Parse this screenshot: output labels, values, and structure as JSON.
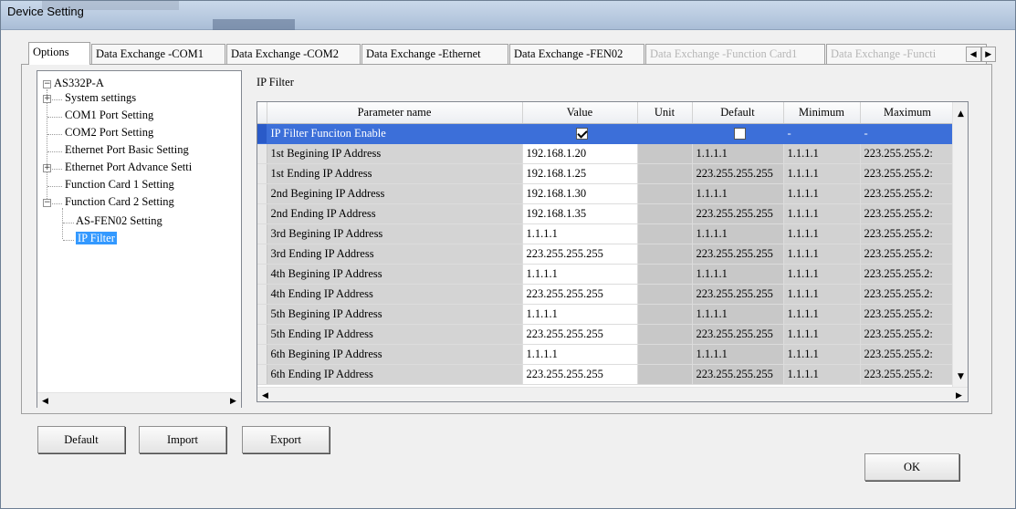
{
  "window": {
    "title": "Device Setting"
  },
  "tabs": [
    {
      "label": "Options",
      "state": "active"
    },
    {
      "label": "Data Exchange -COM1",
      "state": "normal"
    },
    {
      "label": "Data Exchange -COM2",
      "state": "normal"
    },
    {
      "label": "Data Exchange -Ethernet",
      "state": "normal"
    },
    {
      "label": "Data Exchange -FEN02",
      "state": "normal"
    },
    {
      "label": "Data Exchange -Function Card1",
      "state": "disabled"
    },
    {
      "label": "Data Exchange -Functi",
      "state": "disabled"
    }
  ],
  "tab_scroll": {
    "left_icon": "triangle-left-icon",
    "right_icon": "triangle-right-icon"
  },
  "tree": {
    "root": "AS332P-A",
    "items": [
      {
        "label": "System settings",
        "expander": "+"
      },
      {
        "label": "COM1 Port Setting",
        "expander": ""
      },
      {
        "label": "COM2 Port Setting",
        "expander": ""
      },
      {
        "label": "Ethernet Port Basic Setting",
        "expander": ""
      },
      {
        "label": "Ethernet Port Advance Setti",
        "expander": "+"
      },
      {
        "label": "Function Card 1 Setting",
        "expander": ""
      },
      {
        "label": "Function Card 2 Setting",
        "expander": "-"
      }
    ],
    "children": [
      {
        "label": "AS-FEN02 Setting"
      },
      {
        "label": "IP Filter",
        "selected": true
      }
    ]
  },
  "section_label": "IP Filter",
  "grid": {
    "columns": [
      "Parameter name",
      "Value",
      "Unit",
      "Default",
      "Minimum",
      "Maximum"
    ],
    "rows": [
      {
        "name": "IP Filter Funciton Enable",
        "value": "",
        "value_checkbox": true,
        "value_checked": true,
        "unit": "",
        "default": "",
        "default_checkbox": true,
        "default_checked": false,
        "min": "-",
        "max": "-",
        "selected": true
      },
      {
        "name": "1st Begining IP Address",
        "value": "192.168.1.20",
        "unit": "",
        "default": "1.1.1.1",
        "min": "1.1.1.1",
        "max": "223.255.255.2:"
      },
      {
        "name": "1st Ending IP Address",
        "value": "192.168.1.25",
        "unit": "",
        "default": "223.255.255.255",
        "min": "1.1.1.1",
        "max": "223.255.255.2:"
      },
      {
        "name": "2nd Begining IP Address",
        "value": "192.168.1.30",
        "unit": "",
        "default": "1.1.1.1",
        "min": "1.1.1.1",
        "max": "223.255.255.2:"
      },
      {
        "name": "2nd Ending IP Address",
        "value": "192.168.1.35",
        "unit": "",
        "default": "223.255.255.255",
        "min": "1.1.1.1",
        "max": "223.255.255.2:"
      },
      {
        "name": "3rd Begining IP Address",
        "value": "1.1.1.1",
        "unit": "",
        "default": "1.1.1.1",
        "min": "1.1.1.1",
        "max": "223.255.255.2:"
      },
      {
        "name": "3rd Ending IP Address",
        "value": "223.255.255.255",
        "unit": "",
        "default": "223.255.255.255",
        "min": "1.1.1.1",
        "max": "223.255.255.2:"
      },
      {
        "name": "4th Begining IP Address",
        "value": "1.1.1.1",
        "unit": "",
        "default": "1.1.1.1",
        "min": "1.1.1.1",
        "max": "223.255.255.2:"
      },
      {
        "name": "4th Ending IP Address",
        "value": "223.255.255.255",
        "unit": "",
        "default": "223.255.255.255",
        "min": "1.1.1.1",
        "max": "223.255.255.2:"
      },
      {
        "name": "5th Begining IP Address",
        "value": "1.1.1.1",
        "unit": "",
        "default": "1.1.1.1",
        "min": "1.1.1.1",
        "max": "223.255.255.2:"
      },
      {
        "name": "5th Ending IP Address",
        "value": "223.255.255.255",
        "unit": "",
        "default": "223.255.255.255",
        "min": "1.1.1.1",
        "max": "223.255.255.2:"
      },
      {
        "name": "6th Begining IP Address",
        "value": "1.1.1.1",
        "unit": "",
        "default": "1.1.1.1",
        "min": "1.1.1.1",
        "max": "223.255.255.2:"
      },
      {
        "name": "6th Ending IP Address",
        "value": "223.255.255.255",
        "unit": "",
        "default": "223.255.255.255",
        "min": "1.1.1.1",
        "max": "223.255.255.2:"
      }
    ]
  },
  "buttons": {
    "default": "Default",
    "import": "Import",
    "export": "Export",
    "ok": "OK"
  },
  "icons": {
    "up": "triangle-up-icon",
    "down": "triangle-down-icon",
    "left": "triangle-left-icon",
    "right": "triangle-right-icon"
  }
}
